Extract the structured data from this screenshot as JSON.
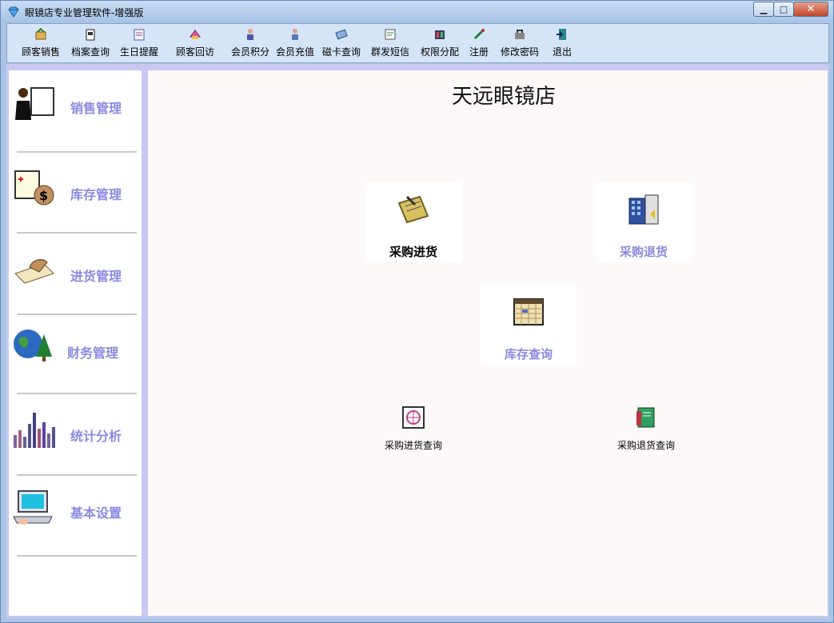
{
  "window": {
    "title": "眼镜店专业管理软件-增强版",
    "controls": [
      "minimize",
      "maximize",
      "close"
    ]
  },
  "toolbar": {
    "items": [
      {
        "label": "顾客销售",
        "icon": "sales-icon"
      },
      {
        "label": "档案查询",
        "icon": "archive-icon"
      },
      {
        "label": "生日提醒",
        "icon": "birthday-icon"
      },
      {
        "label": "顾客回访",
        "icon": "visit-icon"
      },
      {
        "label": "会员积分",
        "icon": "points-icon"
      },
      {
        "label": "会员充值",
        "icon": "recharge-icon"
      },
      {
        "label": "磁卡查询",
        "icon": "card-icon"
      },
      {
        "label": "群发短信",
        "icon": "sms-icon"
      },
      {
        "label": "权限分配",
        "icon": "permission-icon"
      },
      {
        "label": "注册",
        "icon": "register-icon"
      },
      {
        "label": "修改密码",
        "icon": "password-icon"
      },
      {
        "label": "退出",
        "icon": "exit-icon"
      }
    ]
  },
  "sidebar": {
    "items": [
      {
        "label": "销售管理",
        "icon": "presenter-icon"
      },
      {
        "label": "库存管理",
        "icon": "inventory-icon"
      },
      {
        "label": "进货管理",
        "icon": "writing-hand-icon"
      },
      {
        "label": "财务管理",
        "icon": "globe-icon"
      },
      {
        "label": "统计分析",
        "icon": "bar-chart-icon"
      },
      {
        "label": "基本设置",
        "icon": "laptop-icon"
      }
    ]
  },
  "main": {
    "title": "天远眼镜店",
    "tiles": [
      {
        "label": "采购进货",
        "icon": "purchase-icon",
        "color": "#000000"
      },
      {
        "label": "采购退货",
        "icon": "purchase-return-icon",
        "color": "#8a8ae0"
      },
      {
        "label": "库存查询",
        "icon": "calendar-icon",
        "color": "#8a8ae0"
      }
    ],
    "links": [
      {
        "label": "采购进货查询",
        "icon": "purchase-query-icon"
      },
      {
        "label": "采购退货查询",
        "icon": "return-query-icon"
      }
    ]
  },
  "colors": {
    "accent": "#8a8ae0",
    "sidebar_divider": "#c8c8f2",
    "toolbar_bg": "#d5e4f7"
  }
}
